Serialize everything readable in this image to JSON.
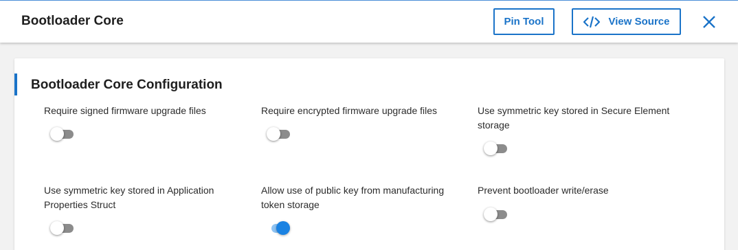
{
  "header": {
    "title": "Bootloader Core",
    "pin_tool_label": "Pin Tool",
    "view_source_label": "View Source",
    "close_icon": "close-icon",
    "code_icon": "code-icon"
  },
  "card": {
    "title": "Bootloader Core Configuration",
    "options": [
      {
        "label": "Require signed firmware upgrade files",
        "enabled": false
      },
      {
        "label": "Require encrypted firmware upgrade files",
        "enabled": false
      },
      {
        "label": "Use symmetric key stored in Secure Element storage",
        "enabled": false
      },
      {
        "label": "Use symmetric key stored in Application Properties Struct",
        "enabled": false
      },
      {
        "label": "Allow use of public key from manufacturing token storage",
        "enabled": true
      },
      {
        "label": "Prevent bootloader write/erase",
        "enabled": false
      }
    ]
  },
  "colors": {
    "accent": "#1a73c8",
    "toggle_on_thumb": "#1a82e2",
    "toggle_on_track": "#8fc3f2",
    "toggle_off_track": "#8c8c8c"
  }
}
